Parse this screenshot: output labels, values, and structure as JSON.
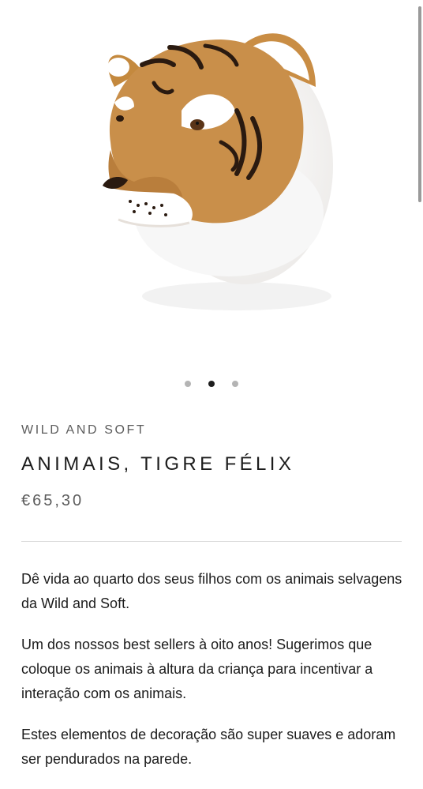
{
  "gallery": {
    "image_alt": "Tiger plush head",
    "dots": [
      {
        "label": "Image 1",
        "active": false
      },
      {
        "label": "Image 2",
        "active": true
      },
      {
        "label": "Image 3",
        "active": false
      }
    ]
  },
  "product": {
    "vendor": "WILD AND SOFT",
    "title": "ANIMAIS, TIGRE FÉLIX",
    "price": "€65,30",
    "description": [
      "Dê vida ao quarto dos seus filhos com os animais selvagens da Wild and Soft.",
      "Um dos nossos best sellers à oito anos! Sugerimos que coloque os animais à altura da criança para incentivar a interação com os animais.",
      "Estes elementos de decoração são super suaves e adoram ser pendurados na parede."
    ]
  },
  "colors": {
    "background": "#ffffff",
    "text": "#1c1c1c",
    "muted_text": "#5c5c5c",
    "dot_inactive": "#b4b4b4",
    "dot_active": "#1e1e1e"
  }
}
